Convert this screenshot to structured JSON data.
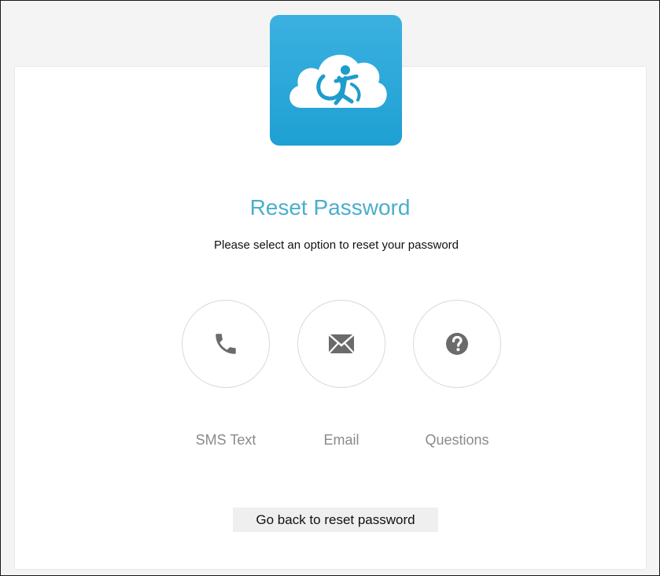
{
  "page": {
    "title": "Reset Password",
    "subtitle": "Please select an option to reset your password"
  },
  "options": [
    {
      "label": "SMS Text",
      "icon": "phone-icon"
    },
    {
      "label": "Email",
      "icon": "envelope-icon"
    },
    {
      "label": "Questions",
      "icon": "question-circle-icon"
    }
  ],
  "actions": {
    "back_label": "Go back to reset password"
  },
  "colors": {
    "logo_background": "#28a8d9",
    "title": "#4aaecc",
    "icon": "#6b6b6b",
    "option_label": "#8a8a8a",
    "button_background": "#efefef"
  }
}
